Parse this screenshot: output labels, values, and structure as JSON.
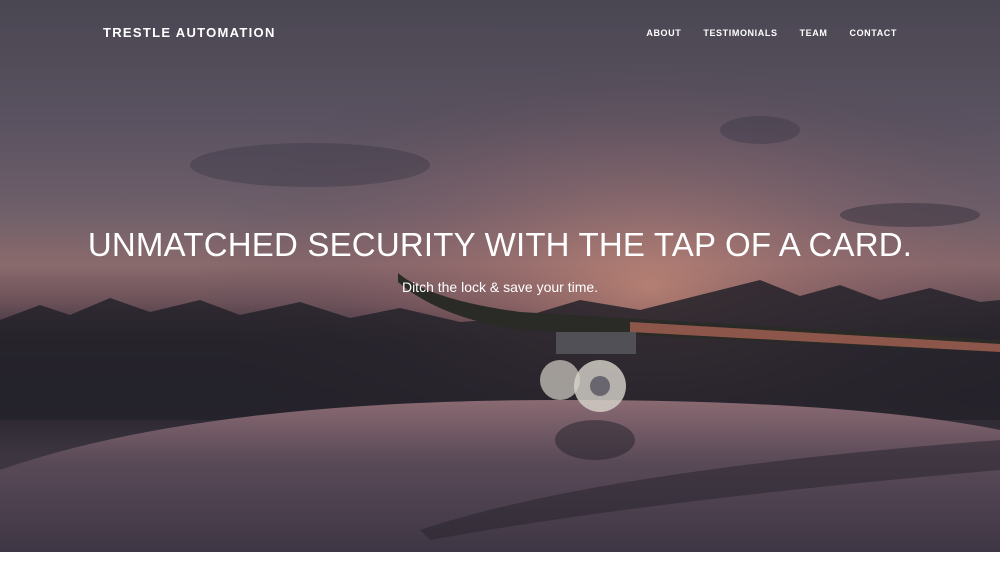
{
  "brand": {
    "name": "TRESTLE AUTOMATION"
  },
  "nav": {
    "items": [
      {
        "label": "ABOUT"
      },
      {
        "label": "TESTIMONIALS"
      },
      {
        "label": "TEAM"
      },
      {
        "label": "CONTACT"
      }
    ]
  },
  "hero": {
    "headline": "UNMATCHED SECURITY WITH THE TAP OF A CARD.",
    "subheadline": "Ditch the lock & save your time.",
    "image_subject": "skateboard-on-car-roof-at-sunset"
  }
}
